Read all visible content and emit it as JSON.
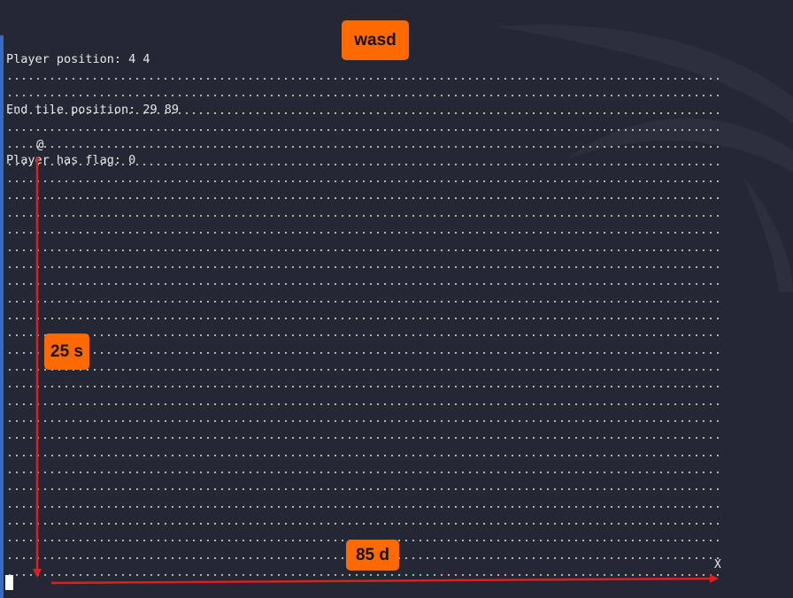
{
  "terminal": {
    "player_position_line": "Player position: 4 4",
    "end_tile_position_line": "End tile position: 29 89",
    "player_has_flag_line": "Player has flag: 0"
  },
  "map": {
    "empty_tile_glyph": ".",
    "player_glyph": "@",
    "end_tile_glyph": "X"
  },
  "annotations": {
    "controls_badge": "wasd",
    "down_moves_badge": "25 s",
    "right_moves_badge": "85 d",
    "arrow_color": "#e01e1e",
    "badge_color": "#ff6a00"
  },
  "theme": {
    "background": "#232834",
    "text_color": "#e8e8e8",
    "accent_bar": "#3a6bc4"
  }
}
